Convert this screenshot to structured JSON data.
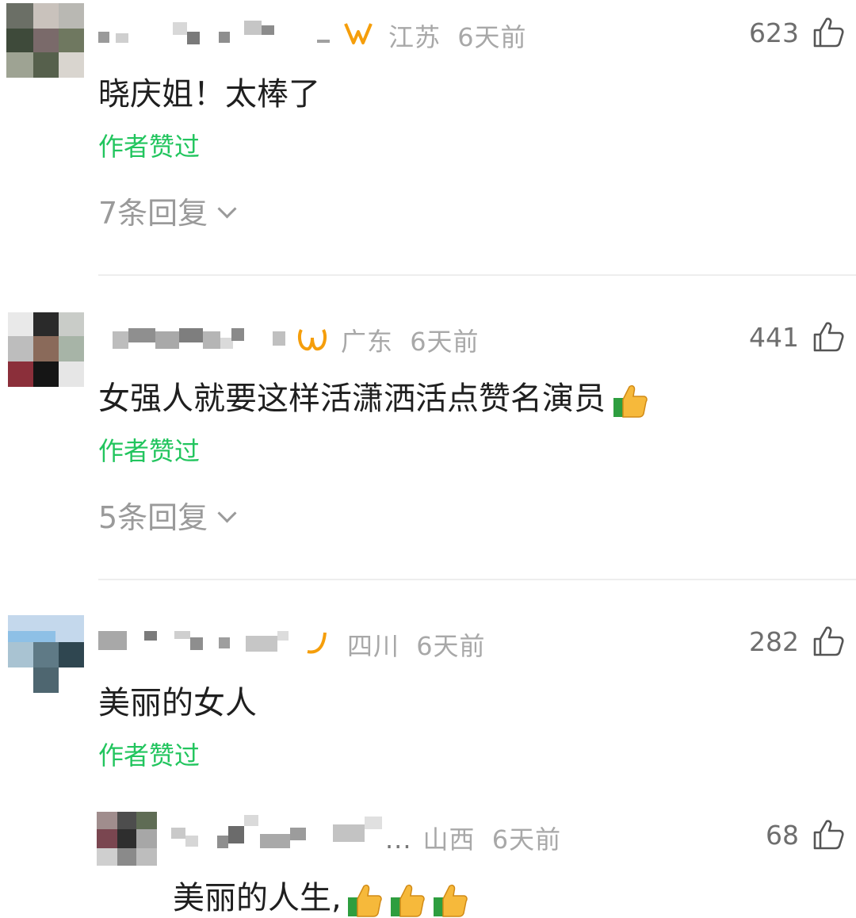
{
  "comments": [
    {
      "region": "江苏",
      "time": "6天前",
      "likes": "623",
      "text": "晓庆姐！太棒了",
      "author_liked": "作者赞过",
      "replies": "7条回复"
    },
    {
      "region": "广东",
      "time": "6天前",
      "likes": "441",
      "text": "女强人就要这样活潇洒活点赞名演员",
      "author_liked": "作者赞过",
      "replies": "5条回复"
    },
    {
      "region": "四川",
      "time": "6天前",
      "likes": "282",
      "text": "美丽的女人",
      "author_liked": "作者赞过"
    }
  ],
  "reply": {
    "region": "山西",
    "time": "6天前",
    "likes": "68",
    "text": "美丽的人生,"
  },
  "colors": {
    "accent_green": "#22c55e",
    "badge_orange": "#f59e0b",
    "meta_gray": "#a8a8a8",
    "thumb_yellow": "#f6b93b",
    "thumb_green": "#2e9e3f"
  },
  "icons": [
    "like-icon",
    "thumbs-up-emoji-icon",
    "region-badge-icon",
    "chevron-down-icon"
  ]
}
